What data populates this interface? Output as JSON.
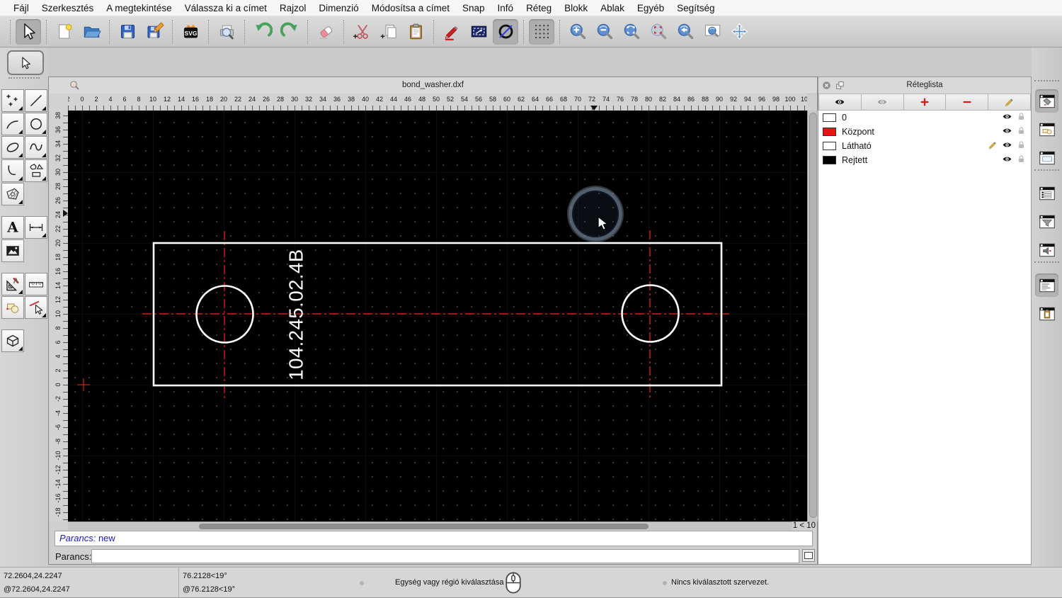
{
  "menu_bar": {
    "items": [
      "Fájl",
      "Szerkesztés",
      "A megtekintése",
      "Válassza ki a címet",
      "Rajzol",
      "Dimenzió",
      "Módosítsa a címet",
      "Snap",
      "Infó",
      "Réteg",
      "Blokk",
      "Ablak",
      "Egyéb",
      "Segítség"
    ]
  },
  "toolbar": {
    "groups": [
      [
        {
          "name": "select",
          "icon": "i-cursor",
          "selected": true
        }
      ],
      [
        {
          "name": "new-document",
          "icon": "i-new"
        },
        {
          "name": "open-file",
          "icon": "i-folder"
        }
      ],
      [
        {
          "name": "save",
          "icon": "i-floppy"
        },
        {
          "name": "save-as",
          "icon": "i-floppy-edit"
        }
      ],
      [
        {
          "name": "export-svg",
          "icon": "i-svg"
        }
      ],
      [
        {
          "name": "print-preview",
          "icon": "i-print-preview"
        }
      ],
      [
        {
          "name": "undo",
          "icon": "i-undo"
        },
        {
          "name": "redo",
          "icon": "i-redo"
        }
      ],
      [
        {
          "name": "delete",
          "icon": "i-eraser"
        }
      ],
      [
        {
          "name": "cut",
          "icon": "i-cut"
        },
        {
          "name": "copy",
          "icon": "i-copy"
        },
        {
          "name": "paste",
          "icon": "i-paste"
        }
      ],
      [
        {
          "name": "pen-attributes",
          "icon": "i-pen"
        },
        {
          "name": "selection-options",
          "icon": "i-select-window"
        },
        {
          "name": "draft-mode",
          "icon": "i-circle-slash",
          "selected": true
        }
      ],
      [
        {
          "name": "grid-toggle",
          "icon": "i-grid",
          "selected": true
        }
      ],
      [
        {
          "name": "zoom-in",
          "icon": "i-zoom-in"
        },
        {
          "name": "zoom-out",
          "icon": "i-zoom-out"
        },
        {
          "name": "zoom-auto",
          "icon": "i-zoom-auto"
        },
        {
          "name": "zoom-redraw",
          "icon": "i-zoom-redraw"
        },
        {
          "name": "zoom-previous",
          "icon": "i-zoom-prev"
        },
        {
          "name": "zoom-window",
          "icon": "i-zoom-window"
        },
        {
          "name": "zoom-pan",
          "icon": "i-zoom-pan"
        }
      ]
    ]
  },
  "left_palette": {
    "select": {
      "name": "select-tool",
      "icon": "i-cursor"
    },
    "groups": [
      [
        {
          "name": "points-tool",
          "icon": "p-points"
        },
        {
          "name": "line-tool",
          "icon": "p-line"
        },
        {
          "name": "arc-tool",
          "icon": "p-arc"
        },
        {
          "name": "circle-tool",
          "icon": "p-circle"
        },
        {
          "name": "ellipse-tool",
          "icon": "p-ellipse"
        },
        {
          "name": "spline-tool",
          "icon": "p-spline"
        },
        {
          "name": "polyline-tool",
          "icon": "p-polyline"
        },
        {
          "name": "shapes-tool",
          "icon": "p-shapes"
        },
        {
          "name": "hatch-tool",
          "icon": "p-hatch"
        }
      ],
      [
        {
          "name": "text-tool",
          "icon": "p-text",
          "flyout": false
        },
        {
          "name": "dimension-tool",
          "icon": "p-dim"
        },
        {
          "name": "image-tool",
          "icon": "p-image",
          "flyout": false
        }
      ],
      [
        {
          "name": "modify-tool",
          "icon": "p-modify"
        },
        {
          "name": "measure-tool",
          "icon": "p-measure",
          "flyout": false
        },
        {
          "name": "block-tool",
          "icon": "p-block",
          "flyout": false
        },
        {
          "name": "select-entity-tool",
          "icon": "p-selectline"
        }
      ],
      [
        {
          "name": "3d-tool",
          "icon": "p-box3d"
        }
      ]
    ]
  },
  "drawing_window": {
    "title": "bond_washer.dxf",
    "part_label": "104.245.02.4B",
    "pager": "1 < 10",
    "outline_color": "#ffffff",
    "centerline_color": "#ff2015",
    "ruler_top_labels": [
      "2",
      "0",
      "2",
      "4",
      "6",
      "8",
      "10",
      "12",
      "14",
      "16",
      "18",
      "20",
      "22",
      "24",
      "26",
      "28",
      "30",
      "32",
      "34",
      "36",
      "38",
      "40",
      "42",
      "44",
      "46",
      "48",
      "50",
      "52",
      "54",
      "56",
      "58",
      "60",
      "62",
      "64",
      "66",
      "68",
      "70",
      "72",
      "74",
      "76",
      "78",
      "80",
      "82",
      "84",
      "86",
      "88",
      "90",
      "92",
      "94",
      "96",
      "98",
      "100",
      "10"
    ],
    "ruler_left_labels": [
      "38",
      "36",
      "34",
      "32",
      "30",
      "28",
      "26",
      "24",
      "22",
      "20",
      "18",
      "16",
      "14",
      "12",
      "10",
      "8",
      "6",
      "4",
      "2",
      "0",
      "-2",
      "-4",
      "-6",
      "-8",
      "-10",
      "-12",
      "-14",
      "-16",
      "-18"
    ]
  },
  "layer_panel": {
    "title": "Réteglista",
    "toolbar": [
      {
        "name": "show-all-layers",
        "icon": "i-eye"
      },
      {
        "name": "hide-inactive-layers",
        "icon": "i-eye-gray"
      },
      {
        "name": "add-layer",
        "icon": "i-plus"
      },
      {
        "name": "remove-layer",
        "icon": "i-minus"
      },
      {
        "name": "edit-layer",
        "icon": "i-pencil"
      }
    ],
    "layers": [
      {
        "name": "0",
        "color": "#ffffff",
        "editing": false
      },
      {
        "name": "Központ",
        "color": "#ee1111",
        "editing": false
      },
      {
        "name": "Látható",
        "color": "#ffffff",
        "editing": true
      },
      {
        "name": "Rejtett",
        "color": "#000000",
        "editing": false
      }
    ]
  },
  "dock_strip": {
    "items": [
      {
        "name": "pen-wizard-widget",
        "icon": "w-pen",
        "selected": true
      },
      {
        "name": "block-list-widget",
        "icon": "w-block"
      },
      {
        "name": "library-browser-widget",
        "icon": "w-lib"
      },
      {
        "sep": true
      },
      {
        "name": "layer-list-widget",
        "icon": "w-list"
      },
      {
        "name": "layer-filter-widget",
        "icon": "w-funnel"
      },
      {
        "name": "entity-info-widget",
        "icon": "w-misc"
      },
      {
        "sep": true
      },
      {
        "name": "command-line-widget",
        "icon": "w-cmd",
        "selected": true
      },
      {
        "name": "clipboard-widget",
        "icon": "w-clip"
      }
    ]
  },
  "command": {
    "history_label": "Parancs:",
    "history_value": "new",
    "prompt_label": "Parancs:",
    "input_value": ""
  },
  "status_bar": {
    "abs_coords": "72.2604,24.2247",
    "rel_coords": "@72.2604,24.2247",
    "abs_polar": "76.2128<19°",
    "rel_polar": "@76.2128<19°",
    "hint": "Egység vagy régió kiválasztása",
    "selection_info": "Nincs kiválasztott szervezet."
  }
}
